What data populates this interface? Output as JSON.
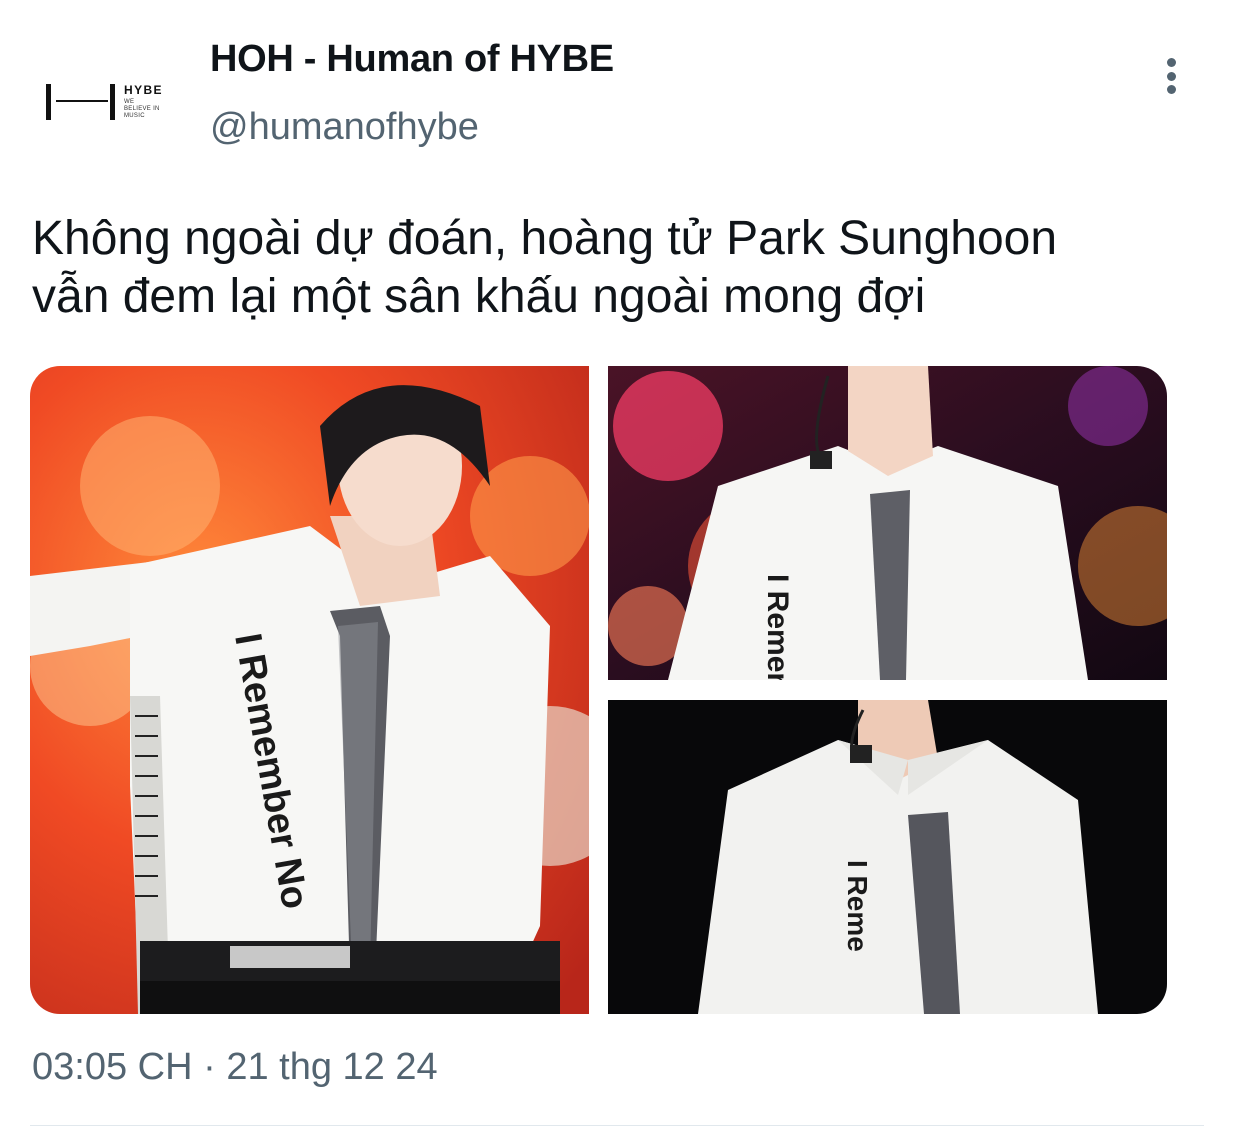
{
  "account": {
    "avatar_brand": "HYBE",
    "avatar_tagline": [
      "WE",
      "BELIEVE IN",
      "MUSIC"
    ],
    "display_name": "HOH - Human of HYBE",
    "handle": "@humanofhybe"
  },
  "tweet": {
    "text_lines": [
      "Không ngoài dự đoán, hoàng tử Park Sunghoon",
      "vẫn đem lại một sân khấu ngoài mong đợi"
    ],
    "time": "03:05 CH",
    "separator": "·",
    "date": "21 thg 12 24"
  },
  "media": {
    "photo_1_shirt_text": "I Remember No",
    "photo_2_shirt_text": "I Remen",
    "photo_3_shirt_text": "I Reme"
  },
  "icons": {
    "more": "more-vertical-icon"
  },
  "colors": {
    "text_primary": "#0f1419",
    "text_secondary": "#536471",
    "divider": "#e1e8ed"
  }
}
